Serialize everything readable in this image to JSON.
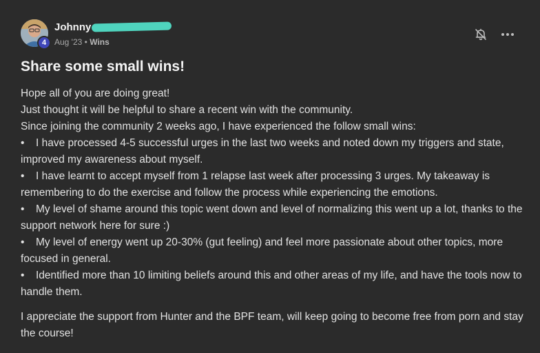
{
  "author": {
    "name": "Johnny",
    "level": "4",
    "date": "Aug '23",
    "separator": "•",
    "category": "Wins"
  },
  "icons": {
    "avatar": "user-photo",
    "notification": "bell-muted-icon",
    "more": "more-horizontal-icon"
  },
  "colors": {
    "background": "#2b2b2b",
    "level_badge": "#3f46b8",
    "redaction": "#4fd4be"
  },
  "post": {
    "title": "Share some small wins!",
    "intro": [
      "Hope all of you are doing great!",
      "Just thought it will be helpful to share a recent win with the community.",
      "Since joining the community 2 weeks ago, I have experienced the follow small wins:"
    ],
    "bullet_char": "•",
    "bullets": [
      "I have processed 4-5 successful urges in the last two weeks and noted down my triggers and state, improved my awareness about myself.",
      "I have learnt to accept myself from 1 relapse last week after processing 3 urges. My takeaway is remembering to do the exercise and follow the process while experiencing the emotions.",
      "My level of shame around this topic went down and level of normalizing this went up a lot, thanks to the support network here for sure :)",
      "My level of energy went up 20-30% (gut feeling) and feel more passionate about other topics, more focused in general.",
      "Identified more than 10 limiting beliefs around this and other areas of my life, and have the tools now to handle them."
    ],
    "closing": "I appreciate the support from Hunter and the BPF team, will keep going to become free from porn and stay the course!"
  }
}
